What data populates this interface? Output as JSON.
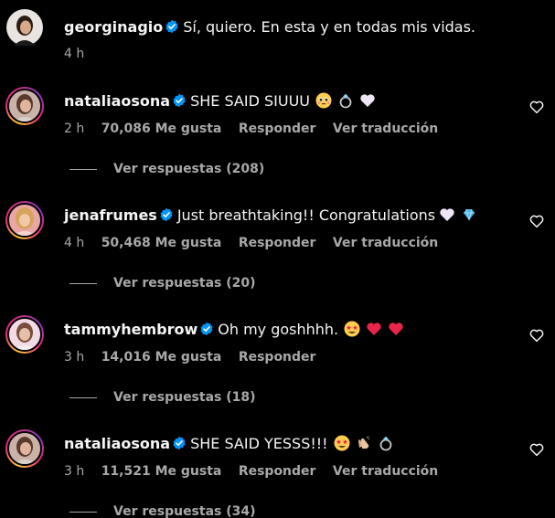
{
  "post": {
    "username": "georginagio",
    "caption": "Sí, quiero. En esta y en todas mis vidas.",
    "time": "4 h",
    "verified_icon": "verified-badge-icon"
  },
  "comments": [
    {
      "username": "nataliaosona",
      "text": "SHE SAID SIUUU",
      "emojis": [
        "pleading-face-emoji",
        "ring-emoji",
        "white-heart-emoji"
      ],
      "time": "2 h",
      "likes": "70,086 Me gusta",
      "reply": "Responder",
      "translate": "Ver traducción",
      "view_replies": "Ver respuestas (208)"
    },
    {
      "username": "jenafrumes",
      "text": "Just breathtaking!! Congratulations",
      "emojis": [
        "white-heart-emoji",
        "gem-emoji"
      ],
      "time": "4 h",
      "likes": "50,468 Me gusta",
      "reply": "Responder",
      "translate": "Ver traducción",
      "view_replies": "Ver respuestas (20)"
    },
    {
      "username": "tammyhembrow",
      "text": "Oh my goshhhh.",
      "emojis": [
        "star-struck-emoji",
        "red-heart-emoji",
        "red-heart-emoji"
      ],
      "time": "3 h",
      "likes": "14,016 Me gusta",
      "reply": "Responder",
      "view_replies": "Ver respuestas (18)"
    },
    {
      "username": "nataliaosona",
      "text": "SHE SAID YESSS!!!",
      "emojis": [
        "star-struck-emoji",
        "clapping-hands-emoji",
        "ring-emoji"
      ],
      "time": "3 h",
      "likes": "11,521 Me gusta",
      "reply": "Responder",
      "translate": "Ver traducción",
      "view_replies": "Ver respuestas (34)"
    }
  ],
  "colors": {
    "background": "#000000",
    "primary_text": "#f5f5f5",
    "secondary_text": "#a8a8a8",
    "verified": "#0095f6"
  }
}
